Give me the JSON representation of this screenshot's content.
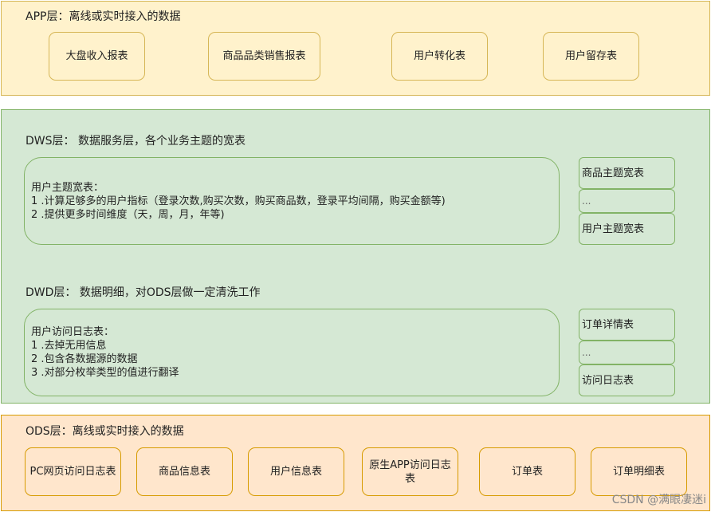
{
  "app_layer": {
    "title": "APP层：离线或实时接入的数据",
    "boxes": [
      "大盘收入报表",
      "商品品类销售报表",
      "用户转化表",
      "用户留存表"
    ]
  },
  "dws_layer": {
    "title": "DWS层：  数据服务层，各个业务主题的宽表",
    "main_box": {
      "heading": "用户主题宽表：",
      "lines": [
        "1 .计算足够多的用户指标（登录次数,购买次数，购买商品数，登录平均间隔，购买金额等)",
        "2 .提供更多时间维度（天，周，月，年等)"
      ]
    },
    "side_boxes": [
      "商品主题宽表",
      "...",
      "用户主题宽表"
    ]
  },
  "dwd_layer": {
    "title": "DWD层：  数据明细，对ODS层做一定清洗工作",
    "main_box": {
      "heading": "用户访问日志表：",
      "lines": [
        "1 .去掉无用信息",
        "2 .包含各数据源的数据",
        "3 .对部分枚举类型的值进行翻译"
      ]
    },
    "side_boxes": [
      "订单详情表",
      "...",
      "访问日志表"
    ]
  },
  "ods_layer": {
    "title": "ODS层：离线或实时接入的数据",
    "boxes": [
      "PC网页访问日志表",
      "商品信息表",
      "用户信息表",
      "原生APP访问日志表",
      "订单表",
      "订单明细表"
    ]
  },
  "watermark": "CSDN @满眼凄迷i",
  "colors": {
    "app_fill": "#fff2cc",
    "app_border": "#d6b656",
    "dws_fill": "#d5e8d4",
    "dws_border": "#82b366",
    "ods_fill": "#ffe6cc",
    "ods_border": "#d79b00"
  }
}
